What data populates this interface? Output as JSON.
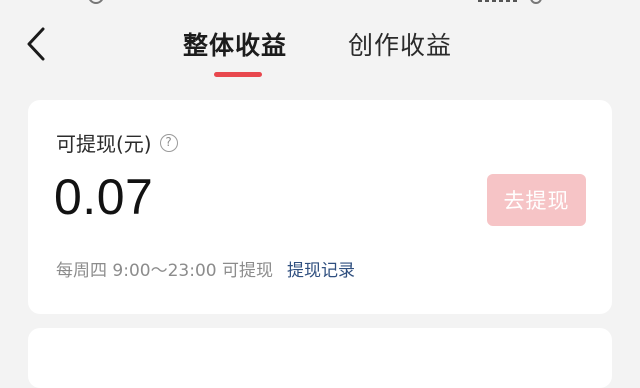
{
  "header": {
    "back_icon": "chevron-left-icon",
    "tabs": [
      {
        "label": "整体收益",
        "active": true
      },
      {
        "label": "创作收益",
        "active": false
      }
    ],
    "accent_color": "#e8474d"
  },
  "withdraw_card": {
    "label": "可提现(元)",
    "help_icon_glyph": "?",
    "amount": "0.07",
    "withdraw_button_label": "去提现",
    "withdraw_button_color": "#f6c4c6",
    "schedule_text": "每周四 9:00～23:00 可提现",
    "records_link": "提现记录",
    "link_color": "#2f4f7f"
  }
}
